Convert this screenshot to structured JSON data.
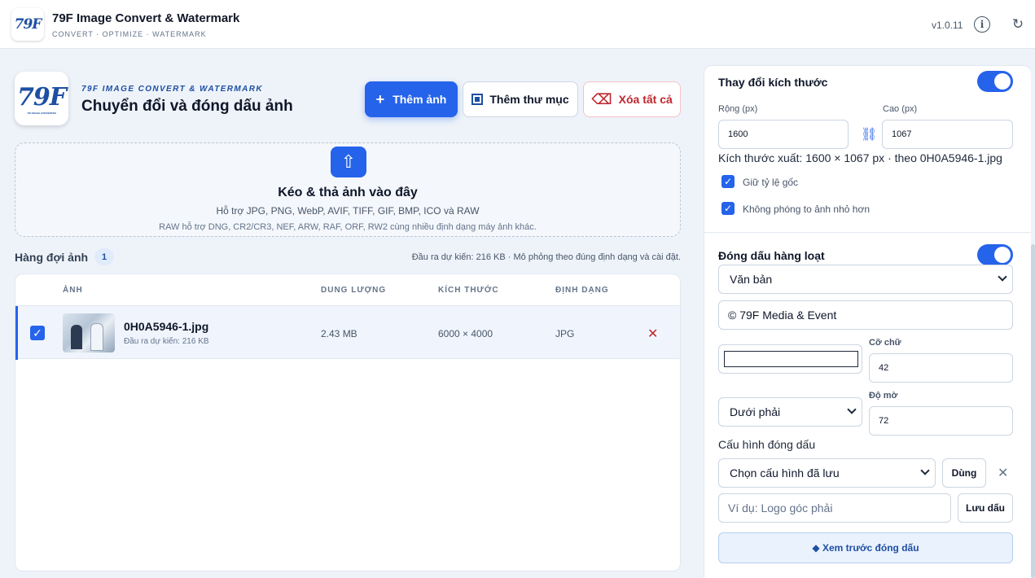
{
  "app": {
    "logo_text": "79F",
    "logo_subtext": "79F IMAGE CONVERTER",
    "title": "79F Image Convert & Watermark",
    "subtitle": "CONVERT · OPTIMIZE · WATERMARK",
    "version": "v1.0.11",
    "icons": {
      "info": "info-icon",
      "refresh": "refresh-icon"
    }
  },
  "header": {
    "kicker": "79F IMAGE CONVERT & WATERMARK",
    "title": "Chuyển đổi và đóng dấu ảnh",
    "buttons": {
      "add": "Thêm ảnh",
      "add_folder": "Thêm thư mục",
      "clear_all": "Xóa tất cả"
    }
  },
  "dropzone": {
    "title": "Kéo & thả ảnh vào đây",
    "formats": "Hỗ trợ JPG, PNG, WebP, AVIF, TIFF, GIF, BMP, ICO và RAW",
    "raw_note": "RAW hỗ trợ DNG, CR2/CR3, NEF, ARW, RAF, ORF, RW2 cùng nhiều định dạng máy ảnh khác."
  },
  "queue": {
    "label": "Hàng đợi ảnh",
    "count": "1",
    "estimate_note": "Đầu ra dự kiến: 216 KB · Mô phỏng theo đúng định dạng và cài đặt.",
    "columns": [
      "ẢNH",
      "DUNG LƯỢNG",
      "KÍCH THƯỚC",
      "ĐỊNH DẠNG"
    ],
    "rows": [
      {
        "file_name": "0H0A5946-1.jpg",
        "estimate": "Đầu ra dự kiến: 216 KB",
        "size": "2.43 MB",
        "dimensions": "6000 × 4000",
        "format": "JPG",
        "selected": true
      }
    ]
  },
  "resize": {
    "title": "Thay đổi kích thước",
    "enabled": true,
    "width_label": "Rộng (px)",
    "width_value": "1600",
    "height_label": "Cao (px)",
    "height_value": "1067",
    "export_size": "Kích thước xuất: 1600 × 1067 px · theo 0H0A5946-1.jpg",
    "keep_ratio_label": "Giữ tỷ lệ gốc",
    "keep_ratio": true,
    "no_upscale_label": "Không phóng to ảnh nhỏ hơn",
    "no_upscale": true
  },
  "watermark": {
    "title": "Đóng dấu hàng loạt",
    "enabled": true,
    "type_selected": "Văn bản",
    "text_value": "© 79F Media & Event",
    "color": "#ffffff",
    "font_size_label": "Cỡ chữ",
    "font_size_value": "42",
    "position_selected": "Dưới phải",
    "opacity_label": "Độ mờ",
    "opacity_value": "72",
    "preset_label": "Cấu hình đóng dấu",
    "preset_selected": "Chọn cấu hình đã lưu",
    "apply_button": "Dùng",
    "preset_name_placeholder": "Ví dụ: Logo góc phải",
    "save_button": "Lưu dấu",
    "preview_button": "◆ Xem trước đóng dấu"
  },
  "colors": {
    "accent": "#2563eb",
    "danger": "#c0262d",
    "brand": "#1d4fa3"
  }
}
